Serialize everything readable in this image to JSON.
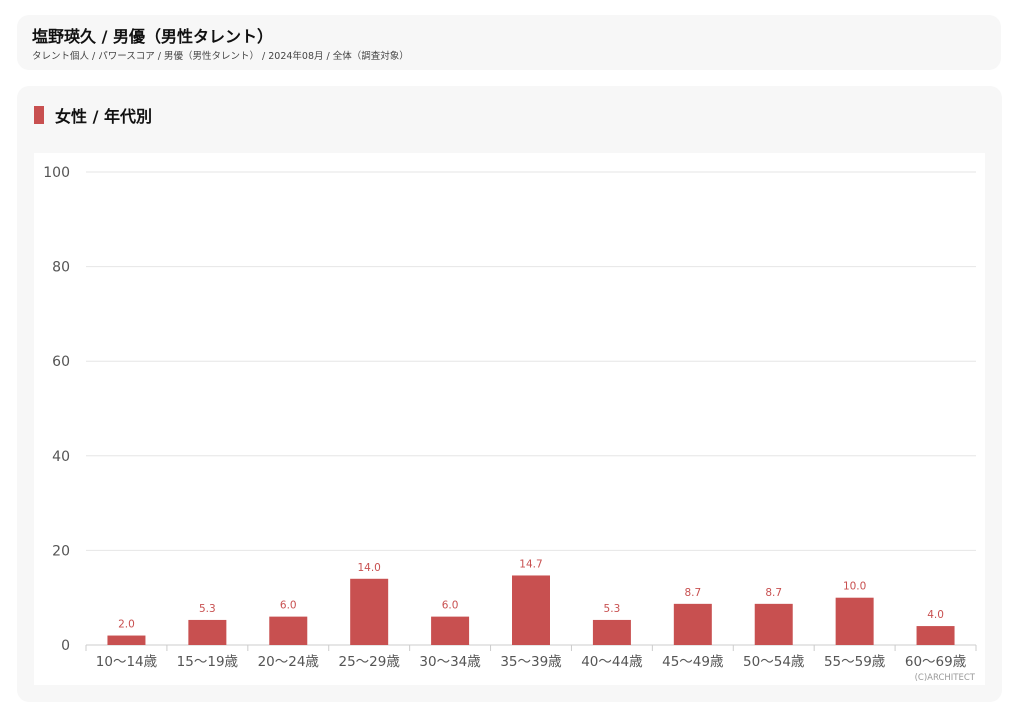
{
  "header": {
    "title": "塩野瑛久 / 男優（男性タレント）",
    "breadcrumb": "タレント個人 / パワースコア / 男優（男性タレント） / 2024年08月 / 全体（調査対象）"
  },
  "section": {
    "title": "女性 / 年代別"
  },
  "copyright": "(C)ARCHITECT",
  "colors": {
    "bar": "#c85050",
    "label": "#c85050",
    "grid": "#e6e6e6",
    "axis_text": "#555555"
  },
  "chart_data": {
    "type": "bar",
    "categories": [
      "10〜14歳",
      "15〜19歳",
      "20〜24歳",
      "25〜29歳",
      "30〜34歳",
      "35〜39歳",
      "40〜44歳",
      "45〜49歳",
      "50〜54歳",
      "55〜59歳",
      "60〜69歳"
    ],
    "values": [
      2.0,
      5.3,
      6.0,
      14.0,
      6.0,
      14.7,
      5.3,
      8.7,
      8.7,
      10.0,
      4.0
    ],
    "value_labels": [
      "2.0",
      "5.3",
      "6.0",
      "14.0",
      "6.0",
      "14.7",
      "5.3",
      "8.7",
      "8.7",
      "10.0",
      "4.0"
    ],
    "y_ticks": [
      "0",
      "20",
      "40",
      "60",
      "80",
      "100"
    ],
    "ylim": [
      0,
      100
    ],
    "grid": true,
    "legend": "none"
  }
}
